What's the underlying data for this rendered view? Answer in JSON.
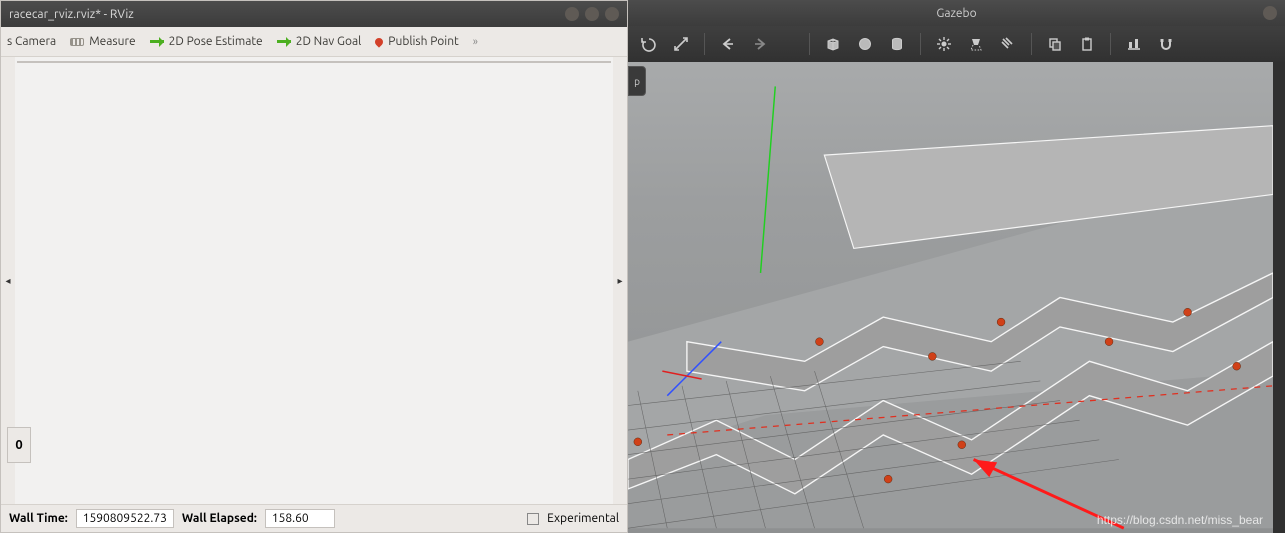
{
  "rviz": {
    "title": "racecar_rviz.rviz* - RViz",
    "toolbar": {
      "camera": "s Camera",
      "measure": "Measure",
      "pose": "2D Pose Estimate",
      "nav": "2D Nav Goal",
      "pub": "Publish Point",
      "more": "»"
    },
    "display_value": "0",
    "arrow_left": "◂",
    "arrow_right": "▸",
    "close_x": "×",
    "status": {
      "walltime_label": "Wall Time:",
      "walltime_value": "1590809522.73",
      "wallelapsed_label": "Wall Elapsed:",
      "wallelapsed_value": "158.60",
      "experimental": "Experimental"
    }
  },
  "gazebo": {
    "title": "Gazebo",
    "panel_tab": "p",
    "icons": {
      "undo": "undo-icon",
      "redo": "redo-icon",
      "scale": "scale-icon",
      "back": "back-icon",
      "fwd": "forward-icon",
      "box": "box-icon",
      "sphere": "sphere-icon",
      "cyl": "cylinder-icon",
      "light": "light-icon",
      "spot": "spotlight-icon",
      "dir": "directional-light-icon",
      "copy": "copy-icon",
      "paste": "paste-icon",
      "align": "align-icon",
      "magnet": "snap-icon"
    }
  },
  "watermark": "https://blog.csdn.net/miss_bear"
}
